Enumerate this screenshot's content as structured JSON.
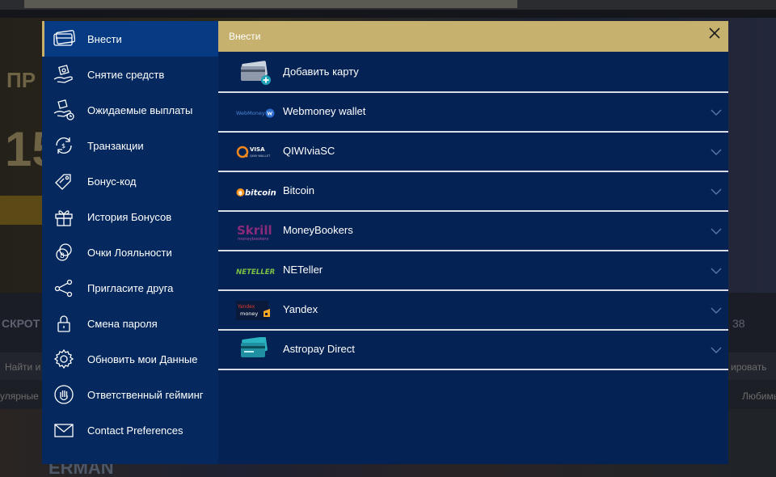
{
  "background": {
    "hero_fragment": "ПР",
    "hero_digits": "15",
    "band_text": "СКРОТ",
    "band_count": "38",
    "search_fragment": "Найти и",
    "sort_fragment": "ировать",
    "tab_popular": "улярные",
    "tab_favorites": "Любимы",
    "game_title": "ERMAN"
  },
  "sidebar": {
    "items": [
      {
        "label": "Внести",
        "icon": "credit-card-icon",
        "active": true
      },
      {
        "label": "Снятие средств",
        "icon": "hand-money-icon"
      },
      {
        "label": "Ожидаемые выплаты",
        "icon": "hand-clock-icon"
      },
      {
        "label": "Транзакции",
        "icon": "transfer-arrows-icon"
      },
      {
        "label": "Бонус-код",
        "icon": "tag-icon"
      },
      {
        "label": "История Бонусов",
        "icon": "gift-icon"
      },
      {
        "label": "Очки Лояльности",
        "icon": "coins-icon"
      },
      {
        "label": "Пригласите друга",
        "icon": "share-icon"
      },
      {
        "label": "Смена пароля",
        "icon": "lock-icon"
      },
      {
        "label": "Обновить мои Данные",
        "icon": "gear-icon"
      },
      {
        "label": "Ответственный гейминг",
        "icon": "hand-stop-icon"
      },
      {
        "label": "Contact Preferences",
        "icon": "envelope-icon"
      }
    ]
  },
  "header": {
    "title": "Внести",
    "close_icon": "close-icon"
  },
  "methods": [
    {
      "label": "Добавить карту",
      "logo": "add-card-icon",
      "expandable": false
    },
    {
      "label": "Webmoney wallet",
      "logo": "webmoney-logo",
      "logo_text": "WebMoney",
      "expandable": true
    },
    {
      "label": "QIWIviaSC",
      "logo": "qiwi-visa-logo",
      "logo_text": "VISA",
      "logo_subtext": "QIWI WALLET",
      "expandable": true
    },
    {
      "label": "Bitcoin",
      "logo": "bitcoin-logo",
      "logo_text": "bitcoin",
      "expandable": true
    },
    {
      "label": "MoneyBookers",
      "logo": "skrill-logo",
      "logo_text": "Skrill",
      "logo_subtext": "moneybookers",
      "expandable": true
    },
    {
      "label": "NETeller",
      "logo": "neteller-logo",
      "logo_text": "NETELLER",
      "expandable": true
    },
    {
      "label": "Yandex",
      "logo": "yandex-money-logo",
      "logo_text": "Yandex",
      "logo_subtext": "money",
      "expandable": true
    },
    {
      "label": "Astropay Direct",
      "logo": "astropay-card-logo",
      "expandable": true
    }
  ],
  "colors": {
    "sidebar_bg": "#05285e",
    "sidebar_active": "#063a82",
    "content_bg": "#052254",
    "header_gold": "#c6b26e",
    "divider": "#d9dde6",
    "chevron": "#5a78b0"
  }
}
